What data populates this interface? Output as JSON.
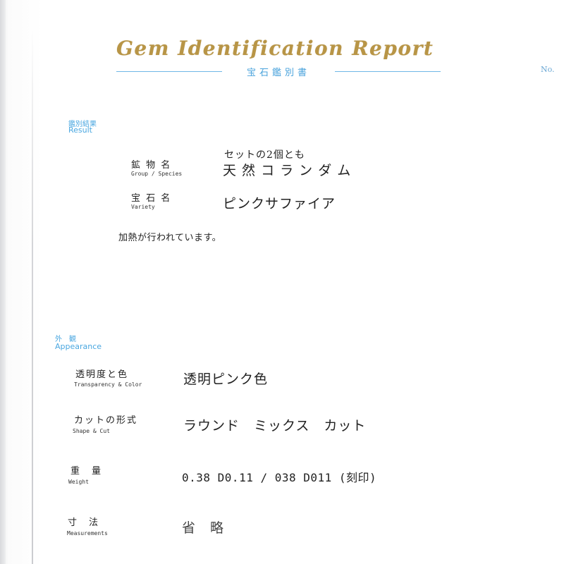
{
  "header": {
    "title": "Gem Identification Report",
    "subtitle": "宝石鑑別書",
    "report_no_label": "No."
  },
  "result_section": {
    "label_ja": "鑑別結果",
    "label_en": "Result",
    "rows": [
      {
        "label_ja": "鉱 物 名",
        "label_en": "Group / Species",
        "value_note": "セットの2個とも",
        "value": "天 然 コ ラ ン ダ ム"
      },
      {
        "label_ja": "宝 石 名",
        "label_en": "Variety",
        "value": "ピンクサファイア"
      }
    ],
    "note": "加熱が行われています。"
  },
  "appearance_section": {
    "label_ja": "外　観",
    "label_en": "Appearance",
    "rows": [
      {
        "label_ja": "透明度と色",
        "label_en": "Transparency & Color",
        "value": "透明ピンク色"
      },
      {
        "label_ja": "カットの形式",
        "label_en": "Shape & Cut",
        "value": "ラウンド　ミックス　カット"
      },
      {
        "label_ja": "重　量",
        "label_en": "Weight",
        "value": "0.38  D0.11 / 038  D011  (刻印)"
      },
      {
        "label_ja": "寸　法",
        "label_en": "Measurements",
        "value": "省　略"
      }
    ]
  },
  "colors": {
    "title_gold": "#b89546",
    "accent_blue": "#4aa7e0",
    "text": "#222222"
  }
}
